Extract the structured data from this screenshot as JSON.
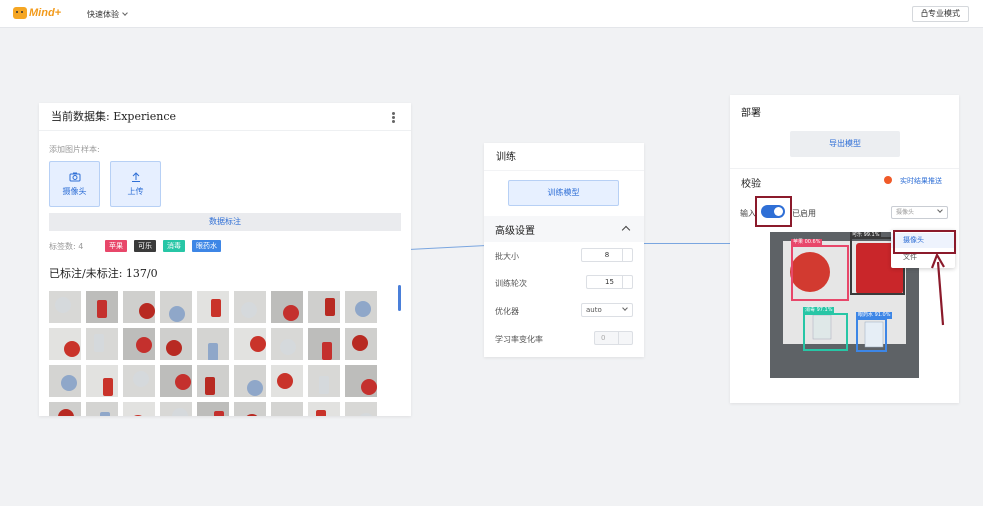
{
  "topbar": {
    "logo_text": "Mind+",
    "menu_label": "快速体验",
    "pro_mode_label": "专业模式"
  },
  "dataset": {
    "title": "当前数据集: Experience",
    "add_samples_label": "添加图片样本:",
    "camera_label": "摄像头",
    "upload_label": "上传",
    "annotate_label": "数据标注",
    "tag_count_label": "标签数: 4",
    "tags": [
      {
        "label": "苹果",
        "color": "#e8476a"
      },
      {
        "label": "可乐",
        "color": "#3a3a3a"
      },
      {
        "label": "消毒",
        "color": "#27c6a6"
      },
      {
        "label": "眼药水",
        "color": "#3d86e6"
      }
    ],
    "annotated_label": "已标注/未标注: 137/0"
  },
  "train": {
    "title": "训练",
    "train_button_label": "训练模型",
    "advanced_label": "高级设置",
    "batch_size_label": "批大小",
    "batch_size_value": "8",
    "epochs_label": "训练轮次",
    "epochs_value": "15",
    "optimizer_label": "优化器",
    "optimizer_value": "auto",
    "lr_label": "学习率变化率",
    "lr_value": "0"
  },
  "deploy": {
    "title": "部署",
    "export_label": "导出模型",
    "verify_label": "校验",
    "push_label": "实时结果推送",
    "input_label": "输入",
    "enabled_label": "已启用",
    "source_select_value": "摄像头",
    "dropdown_options": [
      "摄像头",
      "文件"
    ],
    "detections": [
      {
        "label": "苹果 00.6%",
        "color": "#e8476a"
      },
      {
        "label": "可乐 99.1%",
        "color": "#3a3a3a"
      },
      {
        "label": "消毒 97.1%",
        "color": "#27c6a6"
      },
      {
        "label": "眼药水 91.0%",
        "color": "#3d86e6"
      }
    ]
  }
}
